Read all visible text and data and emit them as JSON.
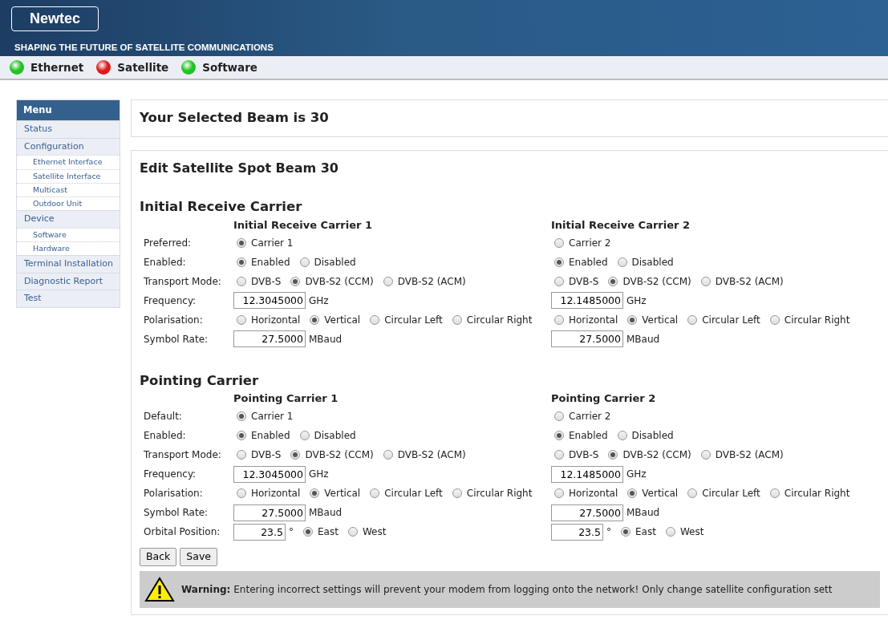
{
  "header": {
    "logo": "Newtec",
    "tagline": "SHAPING THE FUTURE OF SATELLITE COMMUNICATIONS"
  },
  "status": [
    {
      "label": "Ethernet",
      "color": "#22c322"
    },
    {
      "label": "Satellite",
      "color": "#e01818"
    },
    {
      "label": "Software",
      "color": "#22c322"
    }
  ],
  "menu": {
    "title": "Menu",
    "items": [
      {
        "label": "Status"
      },
      {
        "label": "Configuration",
        "children": [
          {
            "label": "Ethernet Interface"
          },
          {
            "label": "Satellite Interface"
          },
          {
            "label": "Multicast"
          },
          {
            "label": "Outdoor Unit"
          }
        ]
      },
      {
        "label": "Device",
        "children": [
          {
            "label": "Software"
          },
          {
            "label": "Hardware"
          }
        ]
      },
      {
        "label": "Terminal Installation"
      },
      {
        "label": "Diagnostic Report"
      },
      {
        "label": "Test"
      }
    ]
  },
  "beam_banner": "Your Selected Beam is 30",
  "form": {
    "title": "Edit Satellite Spot Beam 30",
    "sections": [
      {
        "title": "Initial Receive Carrier",
        "row_labels": [
          "Preferred:",
          "Enabled:",
          "Transport Mode:",
          "Frequency:",
          "Polarisation:",
          "Symbol Rate:"
        ],
        "carriers": [
          {
            "heading": "Initial Receive Carrier 1",
            "fields": [
              {
                "kind": "radio",
                "options": [
                  {
                    "label": "Carrier 1",
                    "selected": true
                  }
                ]
              },
              {
                "kind": "radio",
                "options": [
                  {
                    "label": "Enabled",
                    "selected": true
                  },
                  {
                    "label": "Disabled",
                    "selected": false
                  }
                ]
              },
              {
                "kind": "radio",
                "options": [
                  {
                    "label": "DVB-S",
                    "selected": false
                  },
                  {
                    "label": "DVB-S2 (CCM)",
                    "selected": true
                  },
                  {
                    "label": "DVB-S2 (ACM)",
                    "selected": false
                  }
                ]
              },
              {
                "kind": "number",
                "value": "12.3045000",
                "unit": "GHz"
              },
              {
                "kind": "radio",
                "options": [
                  {
                    "label": "Horizontal",
                    "selected": false
                  },
                  {
                    "label": "Vertical",
                    "selected": true
                  },
                  {
                    "label": "Circular Left",
                    "selected": false
                  },
                  {
                    "label": "Circular Right",
                    "selected": false
                  }
                ]
              },
              {
                "kind": "number",
                "value": "27.5000",
                "unit": "MBaud"
              }
            ]
          },
          {
            "heading": "Initial Receive Carrier 2",
            "fields": [
              {
                "kind": "radio",
                "options": [
                  {
                    "label": "Carrier 2",
                    "selected": false
                  }
                ]
              },
              {
                "kind": "radio",
                "options": [
                  {
                    "label": "Enabled",
                    "selected": true
                  },
                  {
                    "label": "Disabled",
                    "selected": false
                  }
                ]
              },
              {
                "kind": "radio",
                "options": [
                  {
                    "label": "DVB-S",
                    "selected": false
                  },
                  {
                    "label": "DVB-S2 (CCM)",
                    "selected": true
                  },
                  {
                    "label": "DVB-S2 (ACM)",
                    "selected": false
                  }
                ]
              },
              {
                "kind": "number",
                "value": "12.1485000",
                "unit": "GHz"
              },
              {
                "kind": "radio",
                "options": [
                  {
                    "label": "Horizontal",
                    "selected": false
                  },
                  {
                    "label": "Vertical",
                    "selected": true
                  },
                  {
                    "label": "Circular Left",
                    "selected": false
                  },
                  {
                    "label": "Circular Right",
                    "selected": false
                  }
                ]
              },
              {
                "kind": "number",
                "value": "27.5000",
                "unit": "MBaud"
              }
            ]
          }
        ]
      },
      {
        "title": "Pointing Carrier",
        "row_labels": [
          "Default:",
          "Enabled:",
          "Transport Mode:",
          "Frequency:",
          "Polarisation:",
          "Symbol Rate:",
          "Orbital Position:"
        ],
        "carriers": [
          {
            "heading": "Pointing Carrier 1",
            "fields": [
              {
                "kind": "radio",
                "options": [
                  {
                    "label": "Carrier 1",
                    "selected": true
                  }
                ]
              },
              {
                "kind": "radio",
                "options": [
                  {
                    "label": "Enabled",
                    "selected": true
                  },
                  {
                    "label": "Disabled",
                    "selected": false
                  }
                ]
              },
              {
                "kind": "radio",
                "options": [
                  {
                    "label": "DVB-S",
                    "selected": false
                  },
                  {
                    "label": "DVB-S2 (CCM)",
                    "selected": true
                  },
                  {
                    "label": "DVB-S2 (ACM)",
                    "selected": false
                  }
                ]
              },
              {
                "kind": "number",
                "value": "12.3045000",
                "unit": "GHz"
              },
              {
                "kind": "radio",
                "options": [
                  {
                    "label": "Horizontal",
                    "selected": false
                  },
                  {
                    "label": "Vertical",
                    "selected": true
                  },
                  {
                    "label": "Circular Left",
                    "selected": false
                  },
                  {
                    "label": "Circular Right",
                    "selected": false
                  }
                ]
              },
              {
                "kind": "number",
                "value": "27.5000",
                "unit": "MBaud"
              },
              {
                "kind": "number_radio",
                "value": "23.5",
                "unit": "°",
                "options": [
                  {
                    "label": "East",
                    "selected": true
                  },
                  {
                    "label": "West",
                    "selected": false
                  }
                ]
              }
            ]
          },
          {
            "heading": "Pointing Carrier 2",
            "fields": [
              {
                "kind": "radio",
                "options": [
                  {
                    "label": "Carrier 2",
                    "selected": false
                  }
                ]
              },
              {
                "kind": "radio",
                "options": [
                  {
                    "label": "Enabled",
                    "selected": true
                  },
                  {
                    "label": "Disabled",
                    "selected": false
                  }
                ]
              },
              {
                "kind": "radio",
                "options": [
                  {
                    "label": "DVB-S",
                    "selected": false
                  },
                  {
                    "label": "DVB-S2 (CCM)",
                    "selected": true
                  },
                  {
                    "label": "DVB-S2 (ACM)",
                    "selected": false
                  }
                ]
              },
              {
                "kind": "number",
                "value": "12.1485000",
                "unit": "GHz"
              },
              {
                "kind": "radio",
                "options": [
                  {
                    "label": "Horizontal",
                    "selected": false
                  },
                  {
                    "label": "Vertical",
                    "selected": true
                  },
                  {
                    "label": "Circular Left",
                    "selected": false
                  },
                  {
                    "label": "Circular Right",
                    "selected": false
                  }
                ]
              },
              {
                "kind": "number",
                "value": "27.5000",
                "unit": "MBaud"
              },
              {
                "kind": "number_radio",
                "value": "23.5",
                "unit": "°",
                "options": [
                  {
                    "label": "East",
                    "selected": true
                  },
                  {
                    "label": "West",
                    "selected": false
                  }
                ]
              }
            ]
          }
        ]
      }
    ],
    "buttons": [
      "Back",
      "Save"
    ],
    "warning": "**Warning:** Entering incorrect settings will prevent your modem from logging onto the network! Only change satellite configuration sett"
  }
}
